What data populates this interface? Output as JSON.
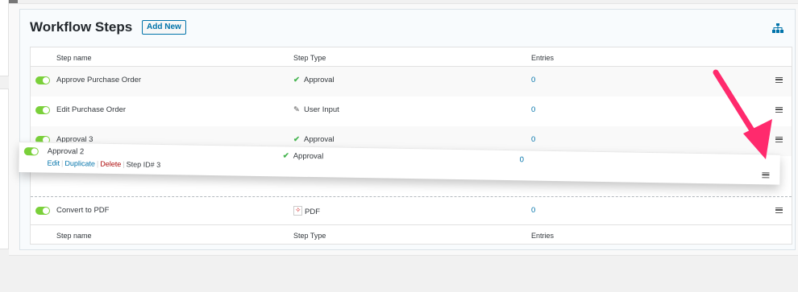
{
  "header": {
    "title": "Workflow Steps",
    "add_new_label": "Add New",
    "tree_icon": "sitemap-icon"
  },
  "columns": {
    "step_name": "Step name",
    "step_type": "Step Type",
    "entries": "Entries"
  },
  "rows": [
    {
      "name": "Approve Purchase Order",
      "type": "Approval",
      "type_icon": "check-icon",
      "entries": "0"
    },
    {
      "name": "Edit Purchase Order",
      "type": "User Input",
      "type_icon": "pencil-icon",
      "entries": "0"
    },
    {
      "name": "Approval 3",
      "type": "Approval",
      "type_icon": "check-icon",
      "entries": "0"
    },
    {
      "name": "Convert to PDF",
      "type": "PDF",
      "type_icon": "pdf-icon",
      "entries": "0"
    }
  ],
  "dragged_row": {
    "name": "Approval 2",
    "type": "Approval",
    "type_icon": "check-icon",
    "entries": "0",
    "actions": {
      "edit": "Edit",
      "duplicate": "Duplicate",
      "delete": "Delete",
      "step_id": "Step ID# 3"
    }
  },
  "colors": {
    "accent": "#0073aa",
    "toggle_on": "#7ad03a",
    "approval_check": "#46b450",
    "delete": "#aa0000",
    "annotation_arrow": "#ff2a6d"
  }
}
